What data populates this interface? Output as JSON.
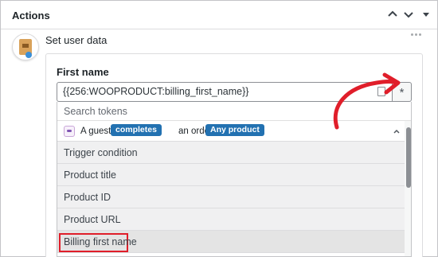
{
  "panel": {
    "title": "Actions"
  },
  "action": {
    "title": "Set user data"
  },
  "field": {
    "label": "First name",
    "value": "{{256:WOOPRODUCT:billing_first_name}}"
  },
  "dropdown": {
    "search_placeholder": "Search tokens",
    "group": {
      "text_a_guest": "A guest",
      "pill_completes": "completes",
      "text_order_with": "an order with",
      "pill_any_product": "Any product"
    },
    "items": [
      {
        "label": "Trigger condition"
      },
      {
        "label": "Product title"
      },
      {
        "label": "Product ID"
      },
      {
        "label": "Product URL"
      },
      {
        "label": "Billing first name"
      }
    ]
  },
  "colors": {
    "pill": "#2271b1",
    "highlight": "#e01e2a",
    "arrow": "#e01e2a"
  },
  "icons": {
    "collapse": "chevron-up-icon",
    "expand": "chevron-down-icon",
    "more": "more-icon",
    "token_button": "asterisk-icon"
  }
}
